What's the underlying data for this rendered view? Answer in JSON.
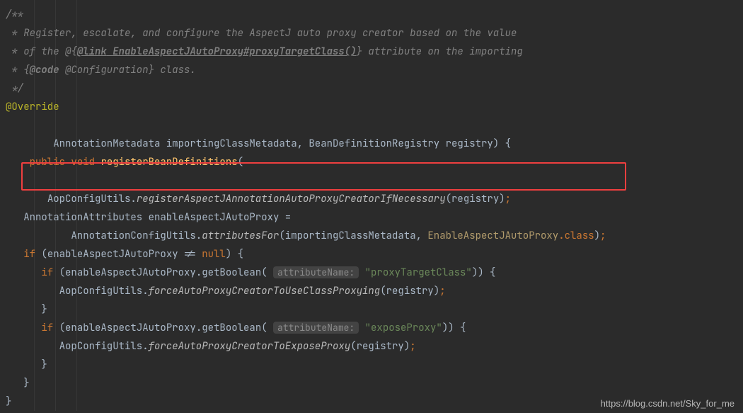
{
  "comment": {
    "l1": "/**",
    "l2_pre": " * Register, escalate, and configure the AspectJ auto proxy creator based on the value",
    "l3_pre": " * of the @{",
    "l3_tag": "@link",
    "l3_link": " EnableAspectJAutoProxy#proxyTargetClass()",
    "l3_post": "} attribute on the importing",
    "l4_pre": " * {",
    "l4_tag": "@code",
    "l4_post": " @Configuration} class.",
    "l5": " */"
  },
  "ann": {
    "override": "@Override"
  },
  "sig": {
    "kw_public": "public",
    "kw_void": "void",
    "name": "registerBeanDefinitions",
    "args_line": "        AnnotationMetadata importingClassMetadata, BeanDefinitionRegistry registry) {"
  },
  "call1": {
    "indent": "   ",
    "cls": "AopConfigUtils.",
    "method": "registerAspectJAnnotationAutoProxyCreatorIfNecessary",
    "tail": "(registry)"
  },
  "attrs": {
    "decl_type": "   AnnotationAttributes enableAspectJAutoProxy =",
    "line2_indent": "           AnnotationConfigUtils.",
    "line2_method": "attributesFor",
    "line2_args_pre": "(importingClassMetadata, ",
    "line2_class": "EnableAspectJAutoProxy",
    "line2_dotclass": ".class",
    "line2_tail": ")"
  },
  "if1": {
    "indent": "   ",
    "kw": "if",
    "cond": " (enableAspectJAutoProxy != ",
    "null": "null",
    "tail": ") {"
  },
  "if2": {
    "indent": "      ",
    "kw": "if",
    "pre": " (enableAspectJAutoProxy.getBoolean( ",
    "hint": "attributeName:",
    "string": " \"proxyTargetClass\"",
    "tail": ")) {"
  },
  "force1": {
    "indent": "         AopConfigUtils.",
    "method": "forceAutoProxyCreatorToUseClassProxying",
    "tail": "(registry)"
  },
  "close_if2": "      }",
  "if3": {
    "indent": "      ",
    "kw": "if",
    "pre": " (enableAspectJAutoProxy.getBoolean( ",
    "hint": "attributeName:",
    "string": " \"exposeProxy\"",
    "tail": ")) {"
  },
  "force2": {
    "indent": "         AopConfigUtils.",
    "method": "forceAutoProxyCreatorToExposeProxy",
    "tail": "(registry)"
  },
  "close_if3": "      }",
  "close_if1": "   }",
  "close_method": "}",
  "semicolon": ";",
  "watermark": "https://blog.csdn.net/Sky_for_me"
}
